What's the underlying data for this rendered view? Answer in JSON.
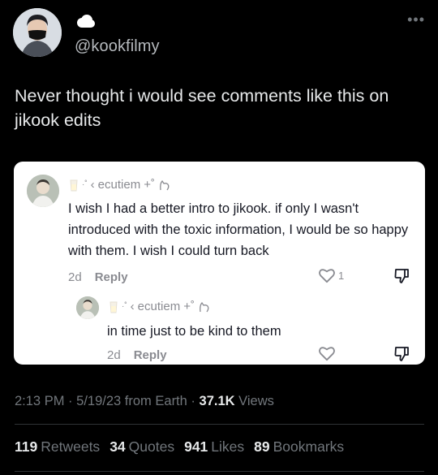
{
  "user": {
    "handle": "@kookfilmy",
    "avatar_icon": "profile-photo",
    "badge_icon": "cloud-emoji",
    "more_icon": "more-dots"
  },
  "tweet": {
    "text": "Never thought i would see comments like this on jikook edits"
  },
  "embed": {
    "comments": [
      {
        "username": "ecutiem",
        "username_prefix": "‹",
        "decor_icons": [
          "milk-glass-icon",
          "sparkle-icon",
          "plus-sparkle-icon",
          "cat-heart-icon"
        ],
        "text": "I wish I had a better intro to jikook. if only I wasn't introduced with the toxic information, I would be so happy with them. I wish I could turn back",
        "time": "2d",
        "reply_label": "Reply",
        "like_count": "1"
      },
      {
        "username": "ecutiem",
        "username_prefix": "‹",
        "decor_icons": [
          "milk-glass-icon",
          "sparkle-icon",
          "plus-sparkle-icon",
          "cat-heart-icon"
        ],
        "text": "in time just to be kind to them",
        "time": "2d",
        "reply_label": "Reply",
        "like_count": ""
      }
    ],
    "colors": {
      "background": "#ffffff",
      "text": "#161823",
      "muted": "#8a8b91"
    }
  },
  "meta": {
    "time": "2:13 PM",
    "date": "5/19/23",
    "source": "from Earth",
    "views_count": "37.1K",
    "views_label": "Views"
  },
  "stats": {
    "retweets_count": "119",
    "retweets_label": "Retweets",
    "quotes_count": "34",
    "quotes_label": "Quotes",
    "likes_count": "941",
    "likes_label": "Likes",
    "bookmarks_count": "89",
    "bookmarks_label": "Bookmarks"
  },
  "colors": {
    "page_bg": "#000000",
    "text": "#e7e9ea",
    "muted": "#71767b",
    "divider": "#2f3336"
  }
}
